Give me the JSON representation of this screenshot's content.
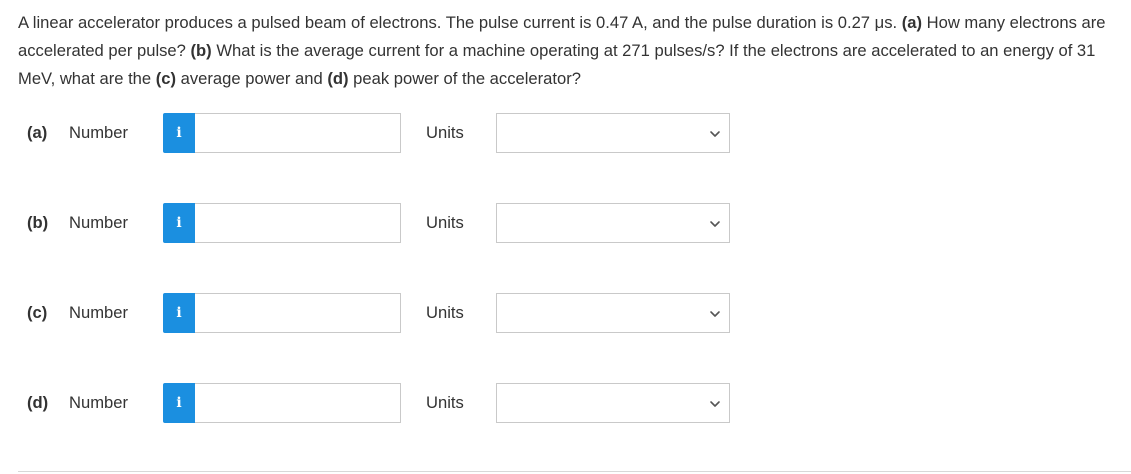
{
  "question": {
    "part1": "A linear accelerator produces a pulsed beam of electrons. The pulse current is 0.47 A, and the pulse duration is 0.27 μs. ",
    "a_tag": "(a)",
    "part2": " How many electrons are accelerated per pulse? ",
    "b_tag": "(b)",
    "part3": " What is the average current for a machine operating at 271 pulses/s? If the electrons are accelerated to an energy of 31 MeV, what are the ",
    "c_tag": "(c)",
    "part4": " average power and ",
    "d_tag": "(d)",
    "part5": " peak power of the accelerator?"
  },
  "rows": [
    {
      "part": "(a)",
      "number_label": "Number",
      "info_icon": "i",
      "value": "",
      "units_label": "Units",
      "unit_selected": ""
    },
    {
      "part": "(b)",
      "number_label": "Number",
      "info_icon": "i",
      "value": "",
      "units_label": "Units",
      "unit_selected": ""
    },
    {
      "part": "(c)",
      "number_label": "Number",
      "info_icon": "i",
      "value": "",
      "units_label": "Units",
      "unit_selected": ""
    },
    {
      "part": "(d)",
      "number_label": "Number",
      "info_icon": "i",
      "value": "",
      "units_label": "Units",
      "unit_selected": ""
    }
  ],
  "colors": {
    "info_button": "#1b8fe0",
    "text": "#333333",
    "border": "#c9c9c9"
  }
}
